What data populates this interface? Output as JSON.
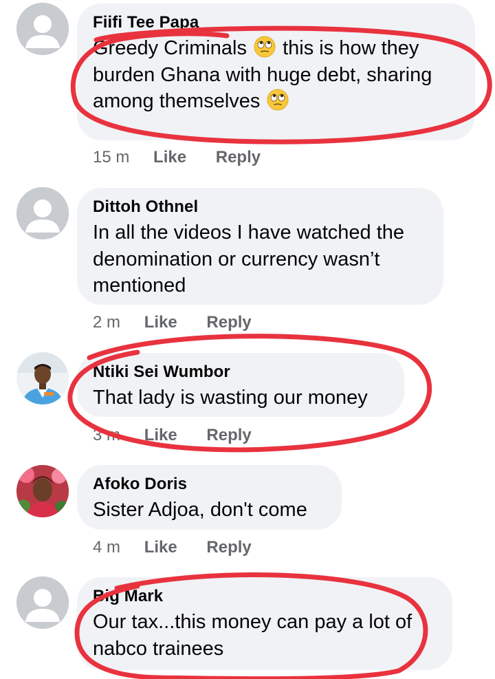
{
  "comments": [
    {
      "author": "Fiifi Tee Papa",
      "text_parts": [
        "Greedy Criminals",
        "this is how they burden Ghana with huge debt, sharing among themselves"
      ],
      "emoji": "face-with-rolling-eyes",
      "time": "15 m",
      "like": "Like",
      "reply": "Reply"
    },
    {
      "author": "Dittoh Othnel",
      "text": "In all the videos I have watched the denomination or currency wasn’t mentioned",
      "time": "2 m",
      "like": "Like",
      "reply": "Reply"
    },
    {
      "author": "Ntiki Sei Wumbor",
      "text": "That lady is wasting our money",
      "time": "3 m",
      "like": "Like",
      "reply": "Reply"
    },
    {
      "author": "Afoko Doris",
      "text": "Sister Adjoa, don't come",
      "time": "4 m",
      "like": "Like",
      "reply": "Reply"
    },
    {
      "author": "Big Mark",
      "text": "Our tax...this money can pay a lot of nabco trainees"
    }
  ],
  "colors": {
    "bubble": "#f0f2f5",
    "meta": "#65676b",
    "annotation": "#e8333f",
    "placeholder_avatar": "#c8cbd0"
  },
  "icons": {
    "default_avatar": "person-silhouette-icon",
    "emoji": "rolling-eyes-emoji-icon"
  }
}
